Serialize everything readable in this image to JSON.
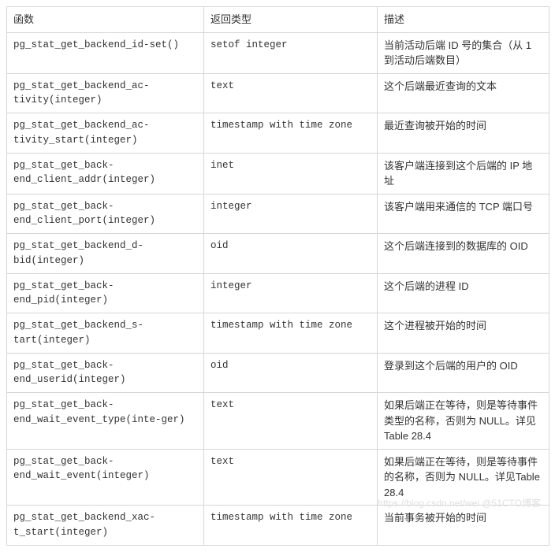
{
  "headers": {
    "func": "函数",
    "rtype": "返回类型",
    "desc": "描述"
  },
  "rows": [
    {
      "func": "pg_stat_get_backend_id-set()",
      "rtype": "setof integer",
      "desc": "当前活动后端 ID 号的集合（从 1 到活动后端数目）"
    },
    {
      "func": "pg_stat_get_backend_ac-tivity(integer)",
      "rtype": "text",
      "desc": "这个后端最近查询的文本"
    },
    {
      "func": "pg_stat_get_backend_ac-tivity_start(integer)",
      "rtype": "timestamp with time zone",
      "desc": "最近查询被开始的时间"
    },
    {
      "func": "pg_stat_get_back-end_client_addr(integer)",
      "rtype": "inet",
      "desc": "该客户端连接到这个后端的 IP 地址"
    },
    {
      "func": "pg_stat_get_back-end_client_port(integer)",
      "rtype": "integer",
      "desc": "该客户端用来通信的 TCP 端口号"
    },
    {
      "func": "pg_stat_get_backend_d-bid(integer)",
      "rtype": "oid",
      "desc": "这个后端连接到的数据库的 OID"
    },
    {
      "func": "pg_stat_get_back-end_pid(integer)",
      "rtype": "integer",
      "desc": "这个后端的进程 ID"
    },
    {
      "func": "pg_stat_get_backend_s-tart(integer)",
      "rtype": "timestamp with time zone",
      "desc": "这个进程被开始的时间"
    },
    {
      "func": "pg_stat_get_back-end_userid(integer)",
      "rtype": "oid",
      "desc": "登录到这个后端的用户的 OID"
    },
    {
      "func": "pg_stat_get_back-end_wait_event_type(inte-ger)",
      "rtype": "text",
      "desc": "如果后端正在等待，则是等待事件类型的名称，否则为 NULL。详见Table 28.4"
    },
    {
      "func": "pg_stat_get_back-end_wait_event(integer)",
      "rtype": "text",
      "desc": "如果后端正在等待，则是等待事件的名称，否则为 NULL。详见Table 28.4"
    },
    {
      "func": "pg_stat_get_backend_xac-t_start(integer)",
      "rtype": "timestamp with time zone",
      "desc": "当前事务被开始的时间"
    }
  ],
  "watermark": "https://blog.csdn.net/wei @51CTO博客"
}
